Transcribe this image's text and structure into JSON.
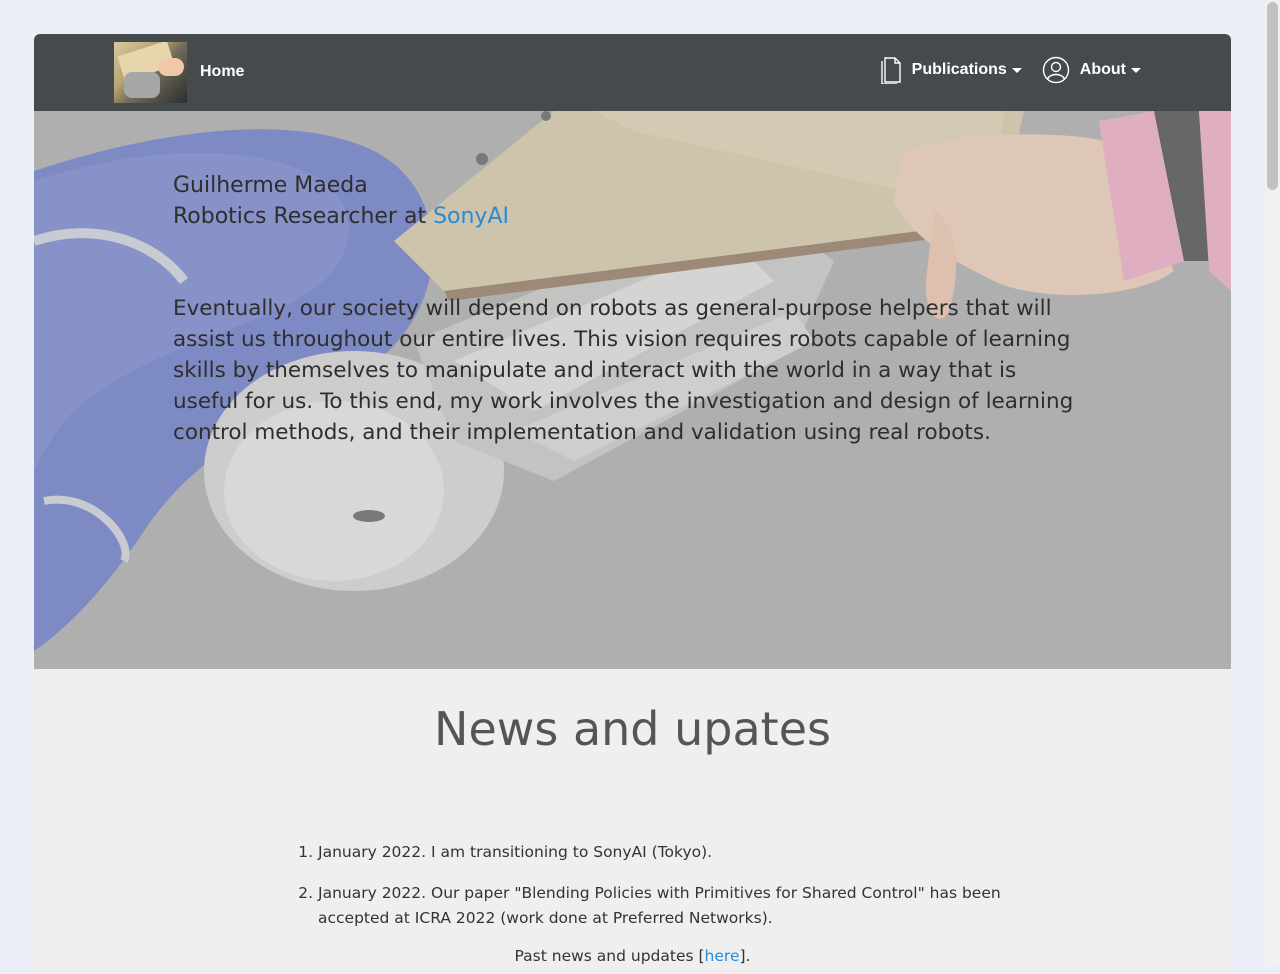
{
  "nav": {
    "home": "Home",
    "publications": "Publications",
    "about": "About",
    "publications_icon": "document-icon",
    "about_icon": "user-icon"
  },
  "hero": {
    "name": "Guilherme Maeda",
    "role_prefix": "Robotics Researcher at ",
    "role_link": "SonyAI",
    "statement": "Eventually, our society will depend on robots as general-purpose helpers that will assist us throughout our entire lives. This vision requires robots capable of learning skills by themselves to manipulate and interact with the world in a way that is useful for us. To this end, my work involves the investigation and design of learning control methods, and their implementation and validation using real robots."
  },
  "news": {
    "title": "News and upates",
    "items": [
      "January 2022. I am transitioning to SonyAI (Tokyo).",
      "January 2022. Our paper \"Blending Policies with Primitives for Shared Control\" has been accepted at ICRA 2022 (work done at Preferred Networks)."
    ],
    "past_prefix": "Past news and updates [",
    "past_link": "here",
    "past_suffix": "]."
  },
  "colors": {
    "navbar": "#454a4d",
    "link": "#2a8ad4",
    "page_bg": "#eceef8"
  }
}
